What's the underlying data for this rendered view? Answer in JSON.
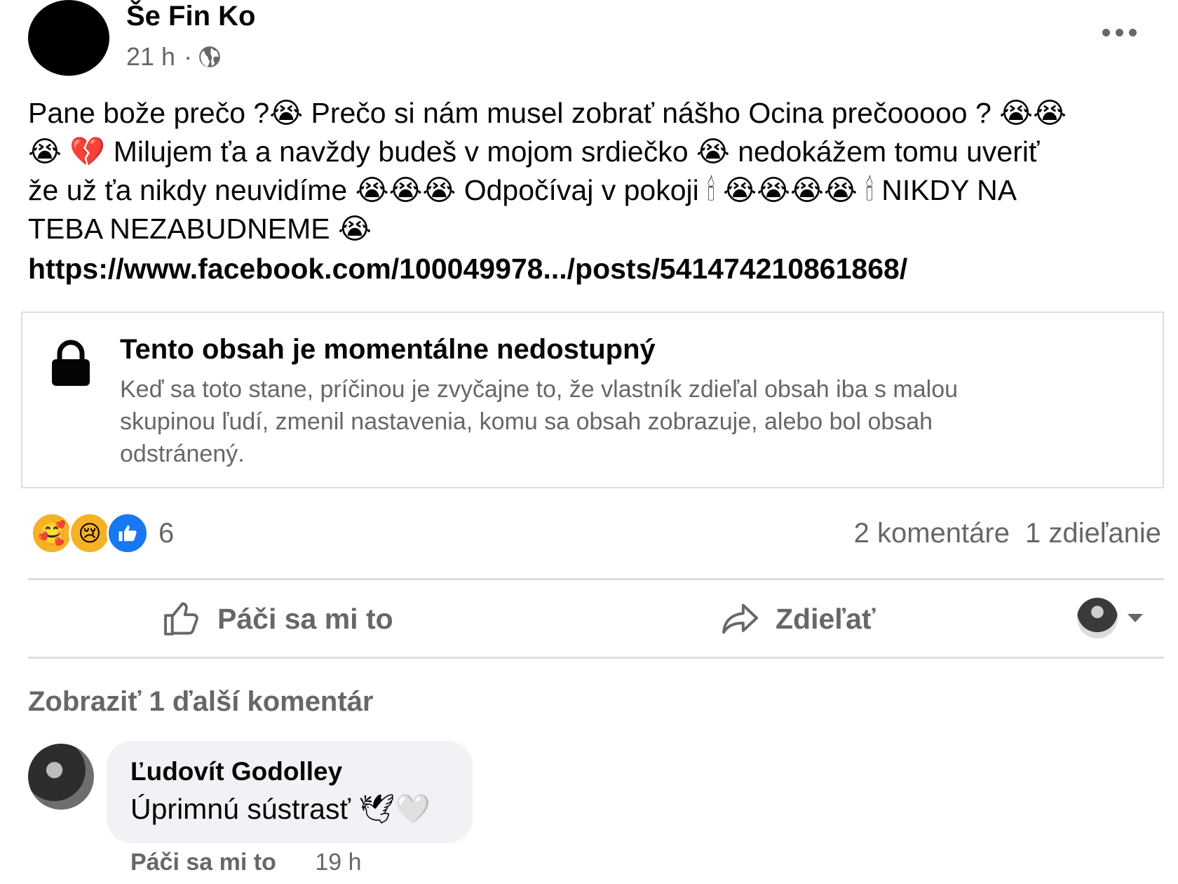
{
  "post": {
    "author": "Še Fin Ko",
    "time": "21 h",
    "separator": "·",
    "audience_icon": "globe-icon",
    "more_icon": "more-options-icon",
    "lines": [
      "Pane bože prečo ?😭 Prečo si nám musel zobrať nášho Ocina prečooooo ? 😭😭",
      "😭 💔 Milujem ťa a navždy budeš  v mojom srdiečko 😭 nedokážem tomu uveriť",
      "že už ťa nikdy neuvidíme 😭😭😭 Odpočívaj v pokoji 🕯 😭😭😭😭 🕯 NIKDY NA",
      "TEBA NEZABUDNEME 😭"
    ],
    "link": "https://www.facebook.com/100049978.../posts/541474210861868/"
  },
  "unavailable": {
    "icon": "lock-icon",
    "title": "Tento obsah je momentálne nedostupný",
    "body_lines": [
      "Keď sa toto stane, príčinou je zvyčajne to, že vlastník zdieľal obsah iba s malou",
      "skupinou ľudí, zmenil nastavenia, komu sa obsah zobrazuje, alebo bol obsah",
      "odstránený."
    ]
  },
  "reactions": {
    "icons": [
      "care-reaction-icon",
      "sad-reaction-icon",
      "like-reaction-icon"
    ],
    "glyphs": [
      "🥰",
      "😢",
      "👍"
    ],
    "count": "6",
    "comments": "2 komentáre",
    "shares": "1 zdieľanie"
  },
  "actions": {
    "like": "Páči sa mi to",
    "share": "Zdieľať"
  },
  "comments": {
    "more": "Zobraziť 1 ďalší komentár",
    "items": [
      {
        "name": "Ľudovít Godolley",
        "text": "Úprimnú sústrasť 🕊🤍",
        "like": "Páči sa mi to",
        "time": "19 h"
      }
    ]
  },
  "colors": {
    "secondary_text": "#65676b",
    "primary_text": "#050505",
    "like_blue": "#1877f2",
    "divider": "#dadde1",
    "bubble": "#f0f2f5"
  }
}
